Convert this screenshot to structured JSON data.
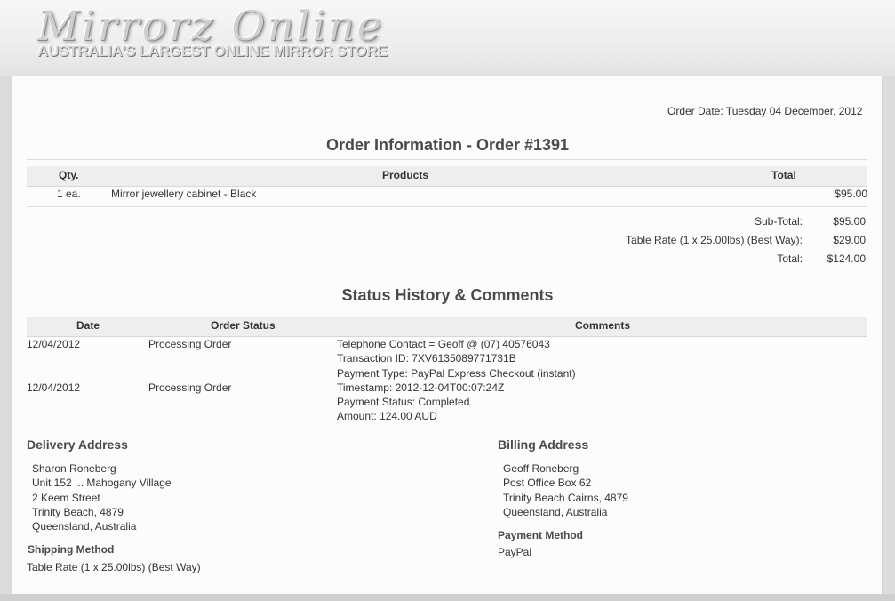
{
  "header": {
    "logo_title": "Mirrorz Online",
    "logo_tagline": "AUSTRALIA'S LARGEST ONLINE MIRROR STORE"
  },
  "order": {
    "date_text": "Order Date: Tuesday 04 December, 2012",
    "title": "Order Information - Order #1391",
    "columns": {
      "qty": "Qty.",
      "products": "Products",
      "total": "Total"
    },
    "items": [
      {
        "qty": "1 ea.",
        "product": "Mirror jewellery cabinet - Black",
        "total": "$95.00"
      }
    ],
    "totals": [
      {
        "label": "Sub-Total:",
        "value": "$95.00"
      },
      {
        "label": "Table Rate (1 x 25.00lbs) (Best Way):",
        "value": "$29.00"
      },
      {
        "label": "Total:",
        "value": "$124.00"
      }
    ]
  },
  "history": {
    "title": "Status History & Comments",
    "columns": {
      "date": "Date",
      "status": "Order Status",
      "comments": "Comments"
    },
    "rows": [
      {
        "date": "12/04/2012",
        "status": "Processing Order",
        "comments": [
          "Telephone Contact = Geoff @ (07) 40576043",
          "Transaction ID: 7XV6135089771731B",
          "Payment Type: PayPal Express Checkout (instant)"
        ]
      },
      {
        "date": "12/04/2012",
        "status": "Processing Order",
        "comments": [
          "Timestamp: 2012-12-04T00:07:24Z",
          "Payment Status: Completed",
          "Amount: 124.00 AUD"
        ]
      }
    ]
  },
  "delivery": {
    "title": "Delivery Address",
    "lines": [
      "Sharon Roneberg",
      "Unit 152 ... Mahogany Village",
      "2 Keem Street",
      "Trinity Beach, 4879",
      "Queensland, Australia"
    ]
  },
  "shipping": {
    "title": "Shipping Method",
    "value": "Table Rate (1 x 25.00lbs) (Best Way)"
  },
  "billing": {
    "title": "Billing Address",
    "lines": [
      "Geoff Roneberg",
      "Post Office Box 62",
      "Trinity Beach Cairns, 4879",
      "Queensland, Australia"
    ]
  },
  "payment": {
    "title": "Payment Method",
    "value": "PayPal"
  }
}
